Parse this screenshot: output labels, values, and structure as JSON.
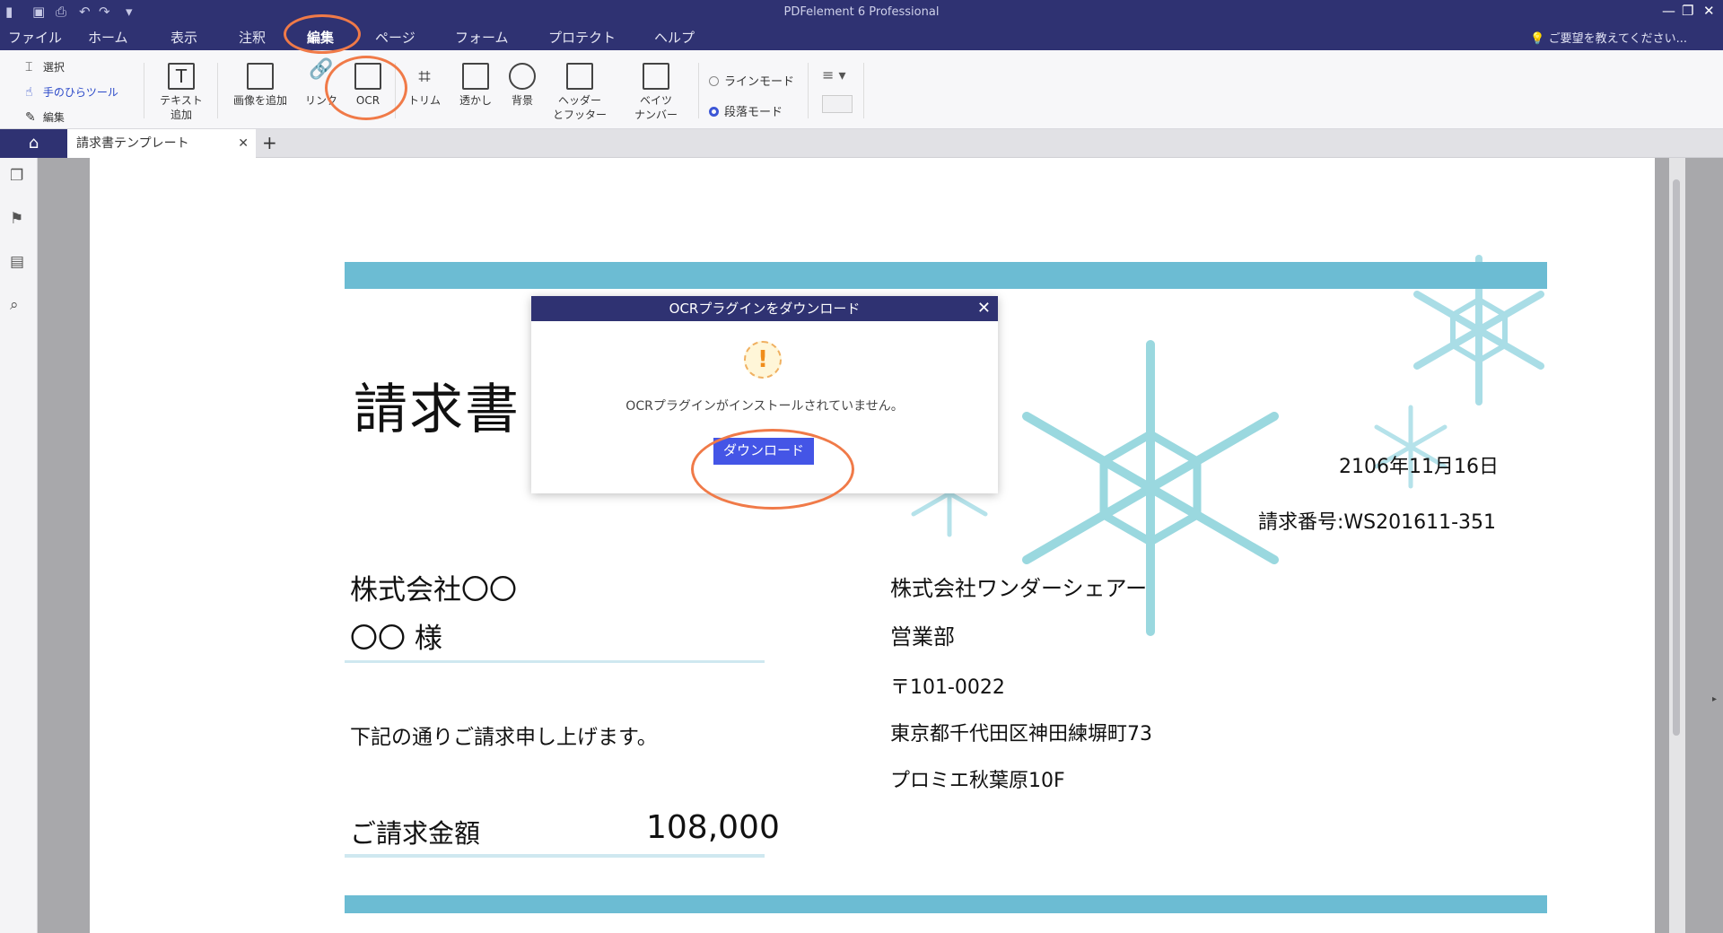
{
  "app": {
    "title": "PDFelement 6 Professional",
    "window_controls": [
      "—",
      "❐",
      "✕"
    ]
  },
  "menu": {
    "items": [
      "ファイル",
      "ホーム",
      "表示",
      "注釈",
      "編集",
      "ページ",
      "フォーム",
      "プロテクト",
      "ヘルプ"
    ],
    "active_index": 4,
    "search_hint": "ご要望を教えてください..."
  },
  "ribbon": {
    "select": "選択",
    "hand": "手のひらツール",
    "edit": "編集",
    "text_add": [
      "テキスト",
      "追加"
    ],
    "image_add": "画像を追加",
    "link": "リンク",
    "ocr": "OCR",
    "trim": "トリム",
    "watermark": "透かし",
    "background": "背景",
    "header_footer": [
      "ヘッダー",
      "とフッター"
    ],
    "bates": [
      "ベイツ",
      "ナンバー"
    ],
    "line_mode": "ラインモード",
    "paragraph_mode": "段落モード"
  },
  "tabs": {
    "doc_name": "請求書テンプレート",
    "close": "✕",
    "add": "+"
  },
  "document": {
    "title": "請求書",
    "date": "2106年11月16日",
    "invoice_no": "請求番号:WS201611-351",
    "client_company": "株式会社〇〇",
    "client_person": "〇〇 様",
    "intro": "下記の通りご請求申し上げます。",
    "amount_label": "ご請求金額",
    "amount_value": "108,000",
    "sender_company": "株式会社ワンダーシェアー",
    "sender_dept": "営業部",
    "postal": "〒101-0022",
    "address1": "東京都千代田区神田練塀町73",
    "address2": "プロミエ秋葉原10F"
  },
  "dialog": {
    "title": "OCRプラグインをダウンロード",
    "message": "OCRプラグインがインストールされていません。",
    "button": "ダウンロード",
    "warning_symbol": "!"
  },
  "colors": {
    "titlebar": "#2f3272",
    "band": "#6cbcd3",
    "snowflake": "#9ad8df",
    "accent_button": "#4455e6",
    "annotation": "#f07a48"
  }
}
